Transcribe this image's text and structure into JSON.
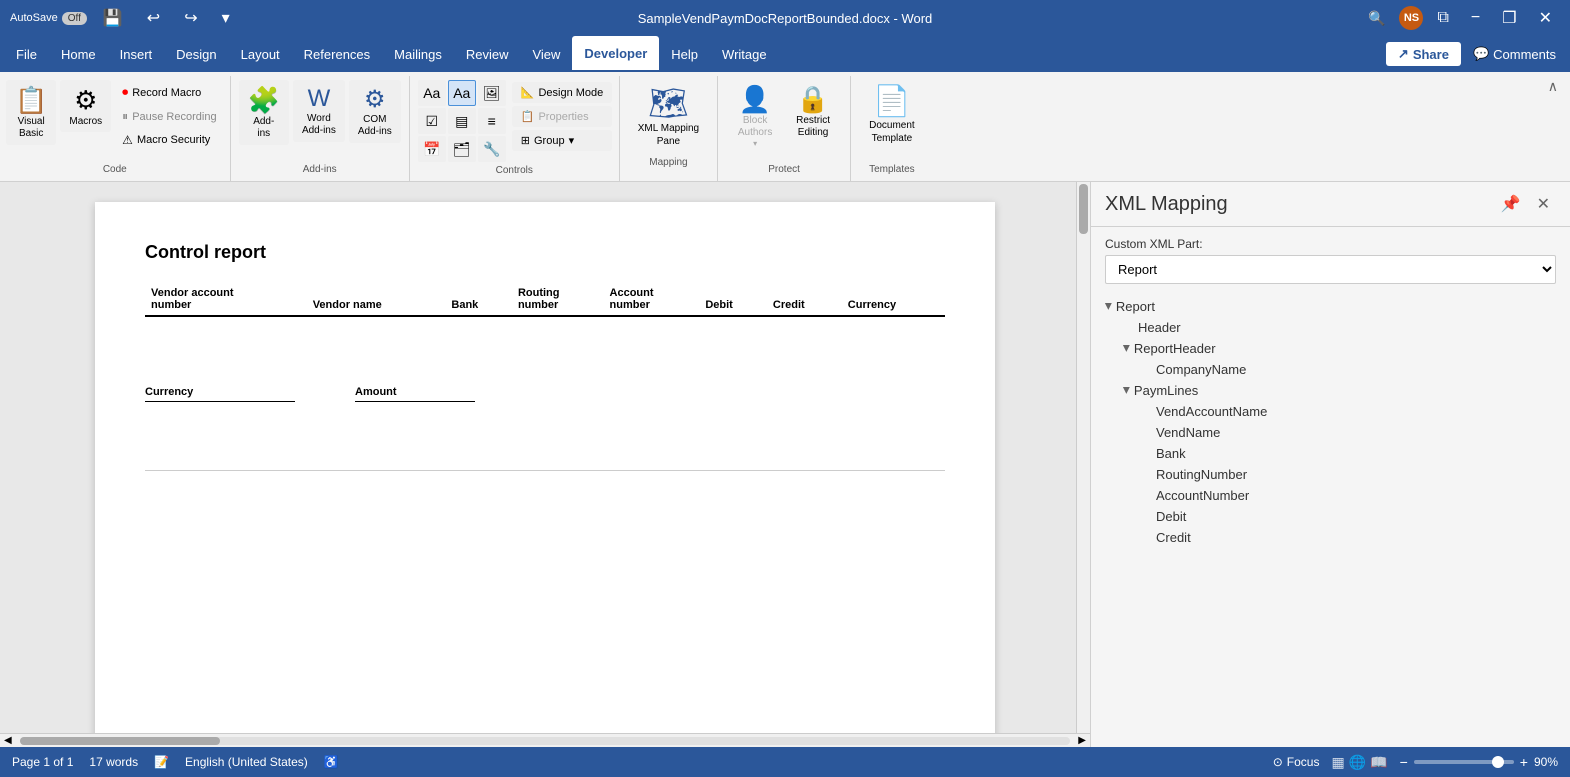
{
  "titleBar": {
    "autosave_label": "AutoSave",
    "autosave_state": "Off",
    "title": "SampleVendPaymDocReportBounded.docx - Word",
    "search_placeholder": "Search",
    "user_initials": "NS",
    "minimize": "−",
    "restore": "❐",
    "close": "✕"
  },
  "menuBar": {
    "items": [
      "File",
      "Home",
      "Insert",
      "Design",
      "Layout",
      "References",
      "Mailings",
      "Review",
      "View",
      "Developer",
      "Help",
      "Writage"
    ],
    "active": "Developer",
    "share_label": "Share",
    "comments_label": "Comments"
  },
  "ribbon": {
    "code_group": {
      "label": "Code",
      "visual_basic_label": "Visual\nBasic",
      "macros_label": "Macros",
      "record_macro_label": "Record Macro",
      "pause_recording_label": "Pause Recording",
      "macro_security_label": "Macro Security"
    },
    "addins_group": {
      "label": "Add-ins",
      "addins_label": "Add-\nins",
      "word_addins_label": "Word\nAdd-ins",
      "com_addins_label": "COM\nAdd-ins"
    },
    "controls_group": {
      "label": "Controls",
      "design_mode_label": "Design Mode",
      "properties_label": "Properties",
      "group_label": "Group"
    },
    "mapping_group": {
      "label": "Mapping",
      "xml_mapping_label": "XML Mapping\nPane"
    },
    "protect_group": {
      "label": "Protect",
      "block_authors_label": "Block\nAuthors",
      "restrict_editing_label": "Restrict\nEditing"
    },
    "templates_group": {
      "label": "Templates",
      "document_template_label": "Document\nTemplate"
    }
  },
  "document": {
    "title": "Control report",
    "table_headers": {
      "vendor_account": "Vendor account\nnumber",
      "vendor_name": "Vendor name",
      "bank": "Bank",
      "routing_number": "Routing\nnumber",
      "account_number": "Account\nnumber",
      "debit": "Debit",
      "credit": "Credit",
      "currency": "Currency"
    },
    "section2_labels": {
      "currency": "Currency",
      "amount": "Amount"
    }
  },
  "xmlPanel": {
    "title": "XML Mapping",
    "custom_xml_part_label": "Custom XML Part:",
    "part_value": "Report",
    "tree": [
      {
        "level": 0,
        "label": "Report",
        "expanded": true,
        "has_arrow": true
      },
      {
        "level": 1,
        "label": "Header",
        "expanded": false,
        "has_arrow": false
      },
      {
        "level": 1,
        "label": "ReportHeader",
        "expanded": true,
        "has_arrow": true
      },
      {
        "level": 2,
        "label": "CompanyName",
        "expanded": false,
        "has_arrow": false
      },
      {
        "level": 1,
        "label": "PaymLines",
        "expanded": true,
        "has_arrow": true
      },
      {
        "level": 2,
        "label": "VendAccountName",
        "expanded": false,
        "has_arrow": false
      },
      {
        "level": 2,
        "label": "VendName",
        "expanded": false,
        "has_arrow": false
      },
      {
        "level": 2,
        "label": "Bank",
        "expanded": false,
        "has_arrow": false
      },
      {
        "level": 2,
        "label": "RoutingNumber",
        "expanded": false,
        "has_arrow": false
      },
      {
        "level": 2,
        "label": "AccountNumber",
        "expanded": false,
        "has_arrow": false
      },
      {
        "level": 2,
        "label": "Debit",
        "expanded": false,
        "has_arrow": false
      },
      {
        "level": 2,
        "label": "Credit",
        "expanded": false,
        "has_arrow": false
      }
    ]
  },
  "statusBar": {
    "page": "Page 1 of 1",
    "words": "17 words",
    "language": "English (United States)",
    "focus_label": "Focus",
    "zoom_percent": "90%"
  }
}
